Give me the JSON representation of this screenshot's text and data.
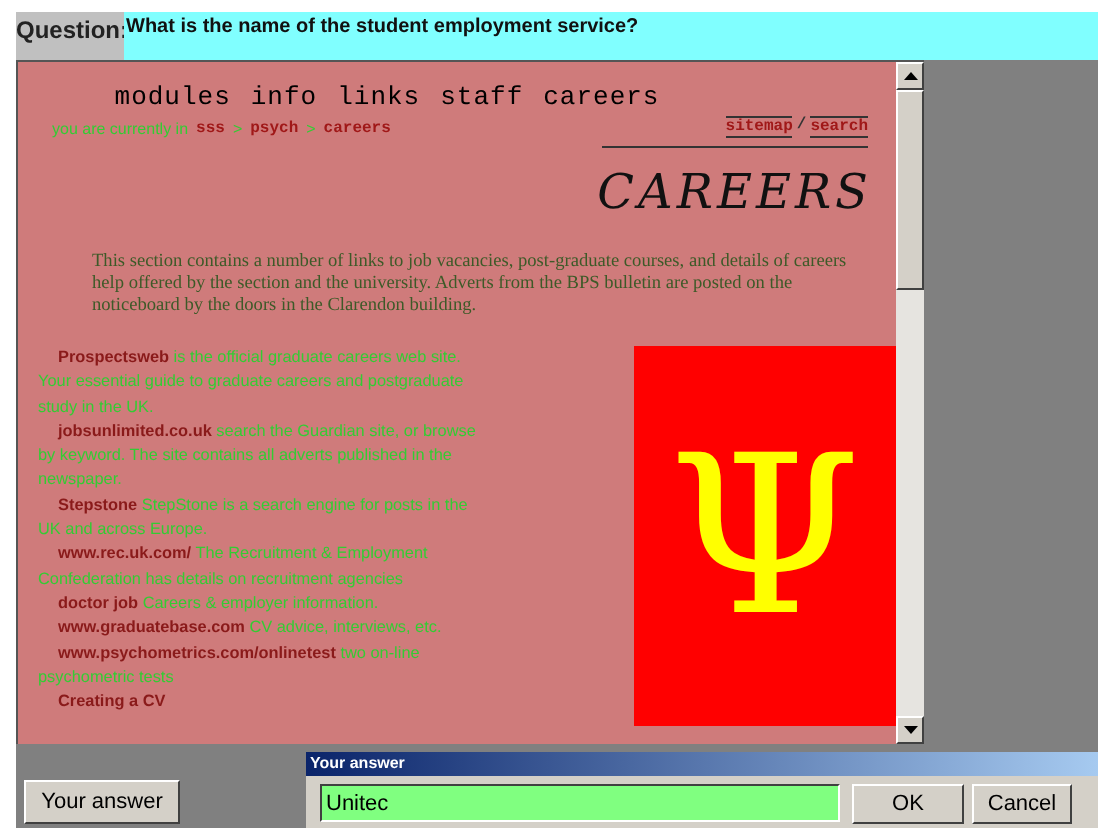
{
  "question": {
    "label": "Question:",
    "text": "What is the name of the student employment service?"
  },
  "page": {
    "nav": [
      "modules",
      "info",
      "links",
      "staff",
      "careers"
    ],
    "breadcrumb": {
      "prefix": "you are currently in",
      "separator": ">",
      "path": [
        "sss",
        "psych",
        "careers"
      ]
    },
    "utility_links": [
      "sitemap",
      "search"
    ],
    "utility_separator": "/",
    "heading": "CAREERS",
    "intro": "This section contains a number of links to job vacancies, post-graduate courses, and details of careers help offered by the section and the university. Adverts from the BPS bulletin are posted on the noticeboard by the doors in the Clarendon building.",
    "links": [
      {
        "name": "Prospectsweb",
        "description": "is the official graduate careers web site. Your essential guide to graduate careers and postgraduate study in the UK."
      },
      {
        "name": "jobsunlimited.co.uk",
        "description": "search the Guardian site, or browse by keyword. The site contains all adverts published in the newspaper."
      },
      {
        "name": "Stepstone",
        "description": "StepStone is a search engine for posts in the UK and across Europe."
      },
      {
        "name": "www.rec.uk.com/",
        "description": "The Recruitment & Employment Confederation has details on recruitment agencies"
      },
      {
        "name": "doctor job",
        "description": "Careers & employer information."
      },
      {
        "name": "www.graduatebase.com",
        "description": "CV advice, interviews, etc."
      },
      {
        "name": "www.psychometrics.com/onlinetest",
        "description": "two on-line psychometric tests"
      },
      {
        "name": "Creating a CV"
      }
    ],
    "logo": "Ψ"
  },
  "answer_button": "Your answer",
  "dialog": {
    "title": "Your answer",
    "value": "Unitec",
    "buttons": [
      "OK",
      "Cancel"
    ]
  }
}
